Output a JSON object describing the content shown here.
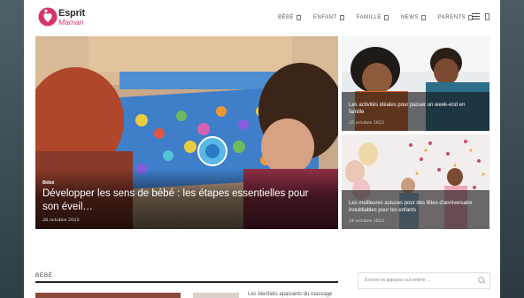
{
  "brand": {
    "name_line1": "Esprit",
    "name_line2": "Maman",
    "accent": "#d8346b"
  },
  "nav": {
    "items": [
      {
        "label": "BÉBÉ"
      },
      {
        "label": "ENFANT"
      },
      {
        "label": "FAMILLE"
      },
      {
        "label": "NEWS"
      },
      {
        "label": "PARENTS"
      }
    ],
    "menu_icon": "hamburger-icon",
    "search_icon": "search-icon"
  },
  "hero": {
    "category": "Bébé",
    "title": "Développer les sens de bébé : les étapes essentielles pour son éveil…",
    "date": "26 octobre 2023"
  },
  "side_cards": [
    {
      "title": "Les activités idéales pour passer un week-end en famille",
      "date": "25 octobre 2023"
    },
    {
      "title": "Les meilleures astuces pour des fêtes d'anniversaire inoubliables pour les enfants",
      "date": "24 octobre 2023"
    }
  ],
  "section": {
    "title": "BÉBÉ",
    "post_snippet": "Les bienfaits apaisants du massage"
  },
  "search": {
    "placeholder": "Écrivez et appuyez sur entrée ..."
  }
}
